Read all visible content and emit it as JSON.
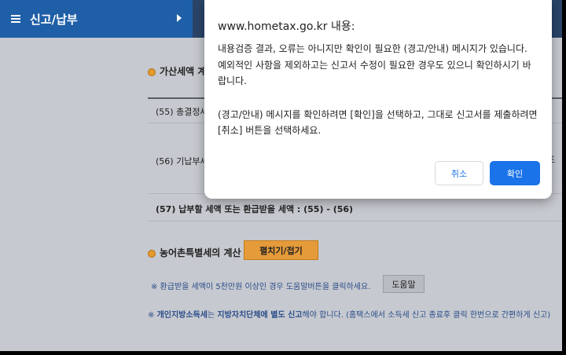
{
  "menu": {
    "title": "신고/납부"
  },
  "sections": {
    "penalty_title": "가산세액 계",
    "farm_title": "농어촌특별세의 계산",
    "fold_button": "펼치기/접기"
  },
  "table": {
    "rows": [
      "(55) 총결정세",
      "(56) 기납부세",
      "(57) 납부할 세액 또는 환급받을 세액 : (55) - (56)"
    ],
    "right_fragment": "또"
  },
  "notes": {
    "refund_note": "※ 환급받을 세액이 5천만원 이상인 경우 도움말버튼을 클릭하세요.",
    "help_button": "도움말",
    "local_tax_prefix": "※ ",
    "local_tax_bold1": "개인지방소득세",
    "local_tax_mid": "는 ",
    "local_tax_bold2": "지방자치단체에 별도 신고",
    "local_tax_rest": "해야 합니다. (홈택스에서 소득세 신고 종료후 클릭 한번으로 간편하게 신고)"
  },
  "dialog": {
    "title": "www.hometax.go.kr 내용:",
    "line1": "내용검증 결과, 오류는 아니지만 확인이 필요한 (경고/안내) 메시지가 있습니다.",
    "line2": "예외적인 사항을 제외하고는 신고서 수정이 필요한 경우도 있으니 확인하시기 바랍니다.",
    "line3": "(경고/안내) 메시지를 확인하려면 [확인]을 선택하고, 그대로 신고서를 제출하려면 [취소] 버튼을 선택하세요.",
    "cancel": "취소",
    "ok": "확인"
  },
  "colors": {
    "accent": "#1a73e8",
    "menu": "#1f5fa7",
    "orange": "#e59b3a"
  }
}
